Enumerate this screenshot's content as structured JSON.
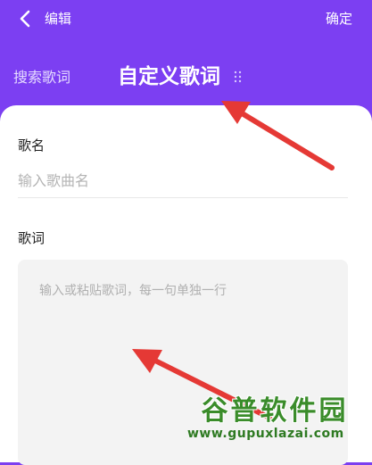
{
  "header": {
    "back_label": "编辑",
    "confirm_label": "确定",
    "tabs": [
      {
        "label": "搜索歌词",
        "active": false
      },
      {
        "label": "自定义歌词",
        "active": true
      }
    ]
  },
  "form": {
    "song_name_label": "歌名",
    "song_name_placeholder": "输入歌曲名",
    "song_name_value": "",
    "lyrics_label": "歌词",
    "lyrics_placeholder": "输入或粘贴歌词，每一句单独一行",
    "lyrics_value": ""
  },
  "watermark": {
    "title": "谷普软件园",
    "url": "www.gupuxlazai.com"
  },
  "colors": {
    "header_bg": "#7c3ff2",
    "annotation_arrow": "#e53935",
    "input_bg": "#f3f3f3",
    "watermark_green": "#3a8c2a"
  }
}
